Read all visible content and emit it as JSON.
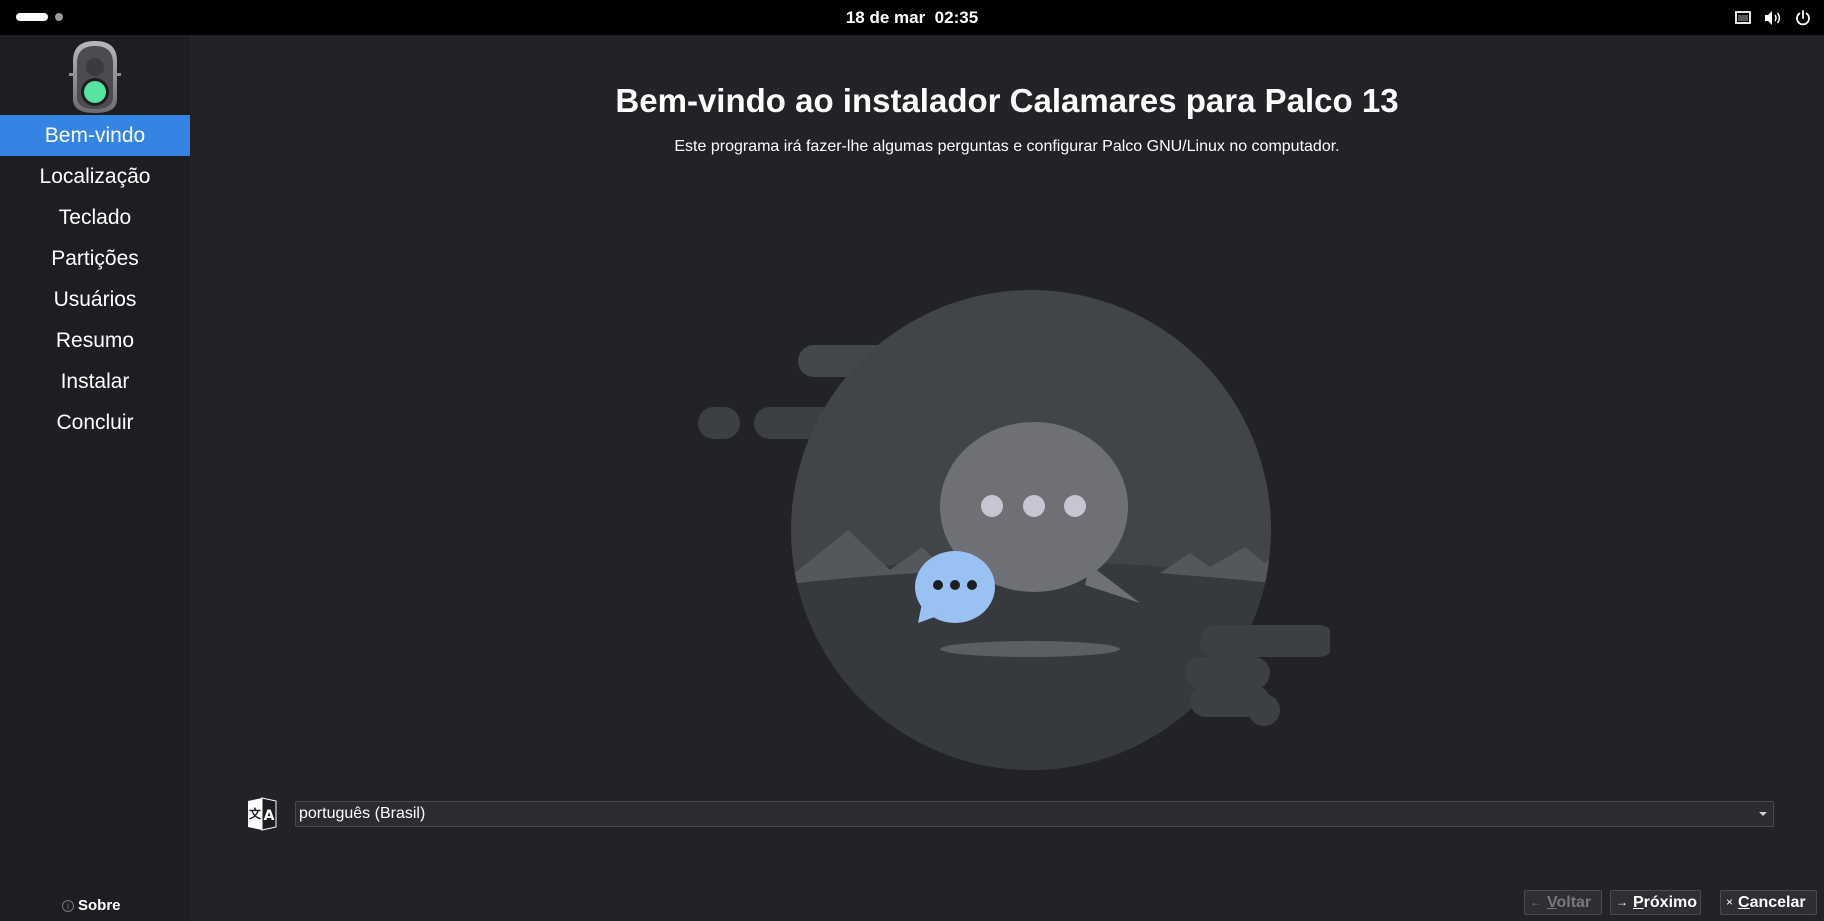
{
  "topbar": {
    "date": "18 de mar",
    "time": "02:35"
  },
  "sidebar": {
    "items": [
      {
        "label": "Bem-vindo",
        "active": true
      },
      {
        "label": "Localização",
        "active": false
      },
      {
        "label": "Teclado",
        "active": false
      },
      {
        "label": "Partições",
        "active": false
      },
      {
        "label": "Usuários",
        "active": false
      },
      {
        "label": "Resumo",
        "active": false
      },
      {
        "label": "Instalar",
        "active": false
      },
      {
        "label": "Concluir",
        "active": false
      }
    ],
    "about_label": "Sobre"
  },
  "main": {
    "title": "Bem-vindo ao instalador Calamares para Palco 13",
    "subtitle": "Este programa irá fazer-lhe algumas perguntas e configurar Palco GNU/Linux no computador."
  },
  "language": {
    "selected": "português (Brasil)"
  },
  "buttons": {
    "back": {
      "label_first": "V",
      "label_rest": "oltar",
      "enabled": false
    },
    "next": {
      "label_first": "P",
      "label_rest": "róximo",
      "enabled": true
    },
    "cancel": {
      "label_first": "C",
      "label_rest": "ancelar",
      "enabled": true
    }
  },
  "colors": {
    "accent": "#3584e4",
    "background": "#232327",
    "sidebar": "#1e1e22",
    "topbar": "#000000"
  },
  "icons": {
    "activities": "activities-indicator-icon",
    "screen": "screen-icon",
    "volume": "volume-icon",
    "power": "power-icon",
    "logo": "traffic-light-logo-icon",
    "language": "language-translate-icon",
    "about": "info-icon"
  }
}
